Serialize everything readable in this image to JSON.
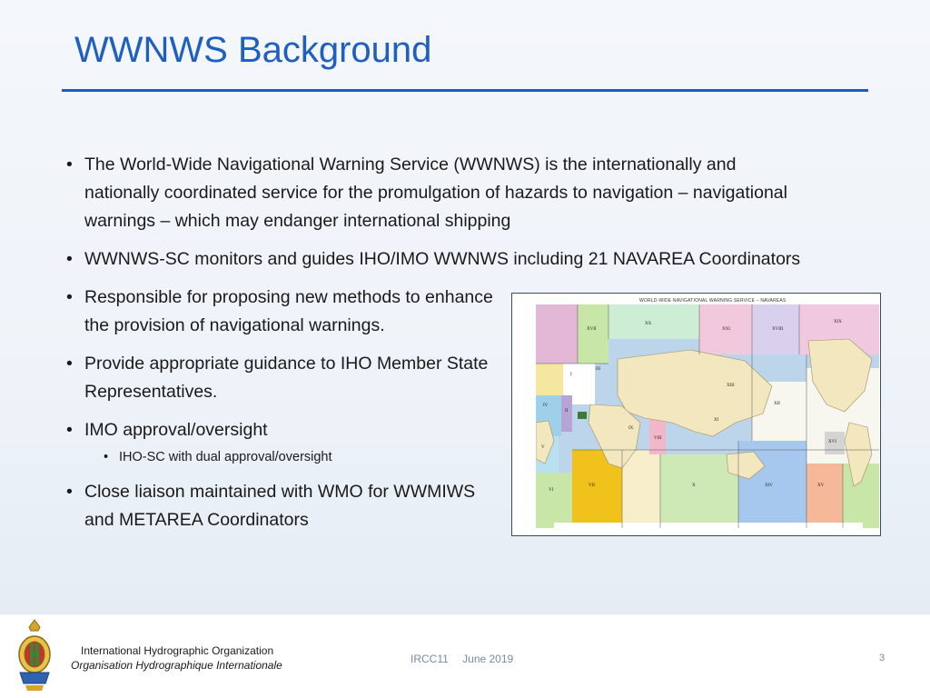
{
  "slide": {
    "title": "WWNWS Background",
    "bullets": [
      "The World-Wide Navigational Warning Service (WWNWS) is the internationally and nationally coordinated service for the promulgation of hazards to navigation – navigational warnings – which may endanger international shipping",
      "WWNWS-SC monitors and guides IHO/IMO WWNWS including 21 NAVAREA Coordinators",
      "Responsible for proposing new methods to enhance the provision of navigational warnings.",
      "Provide appropriate guidance to IHO Member State Representatives.",
      "IMO approval/oversight",
      "Close liaison maintained with WMO for WWMIWS and METAREA Coordinators"
    ],
    "sub_bullets": [
      "IHO-SC with dual approval/oversight"
    ]
  },
  "map": {
    "header": "WORLD-WIDE NAVIGATIONAL WARNING SERVICE – NAVAREAS",
    "regions": [
      {
        "label": "XVII"
      },
      {
        "label": "XX"
      },
      {
        "label": "XXI"
      },
      {
        "label": "XVIII"
      },
      {
        "label": "XIX"
      },
      {
        "label": "I"
      },
      {
        "label": "II"
      },
      {
        "label": "III"
      },
      {
        "label": "IV"
      },
      {
        "label": "V"
      },
      {
        "label": "VI"
      },
      {
        "label": "VII"
      },
      {
        "label": "VIII"
      },
      {
        "label": "IX"
      },
      {
        "label": "X"
      },
      {
        "label": "XI"
      },
      {
        "label": "XII"
      },
      {
        "label": "XIII"
      },
      {
        "label": "XIV"
      },
      {
        "label": "XV"
      },
      {
        "label": "XVI"
      }
    ]
  },
  "footer": {
    "org_en": "International Hydrographic Organization",
    "org_fr": "Organisation Hydrographique Internationale",
    "event": "IRCC11",
    "date": "June 2019",
    "page": "3"
  },
  "colors": {
    "title": "#1f5fbf",
    "rule": "#1a5cc4",
    "ocean": "#bcd5ea",
    "land": "#f3e7c0"
  }
}
